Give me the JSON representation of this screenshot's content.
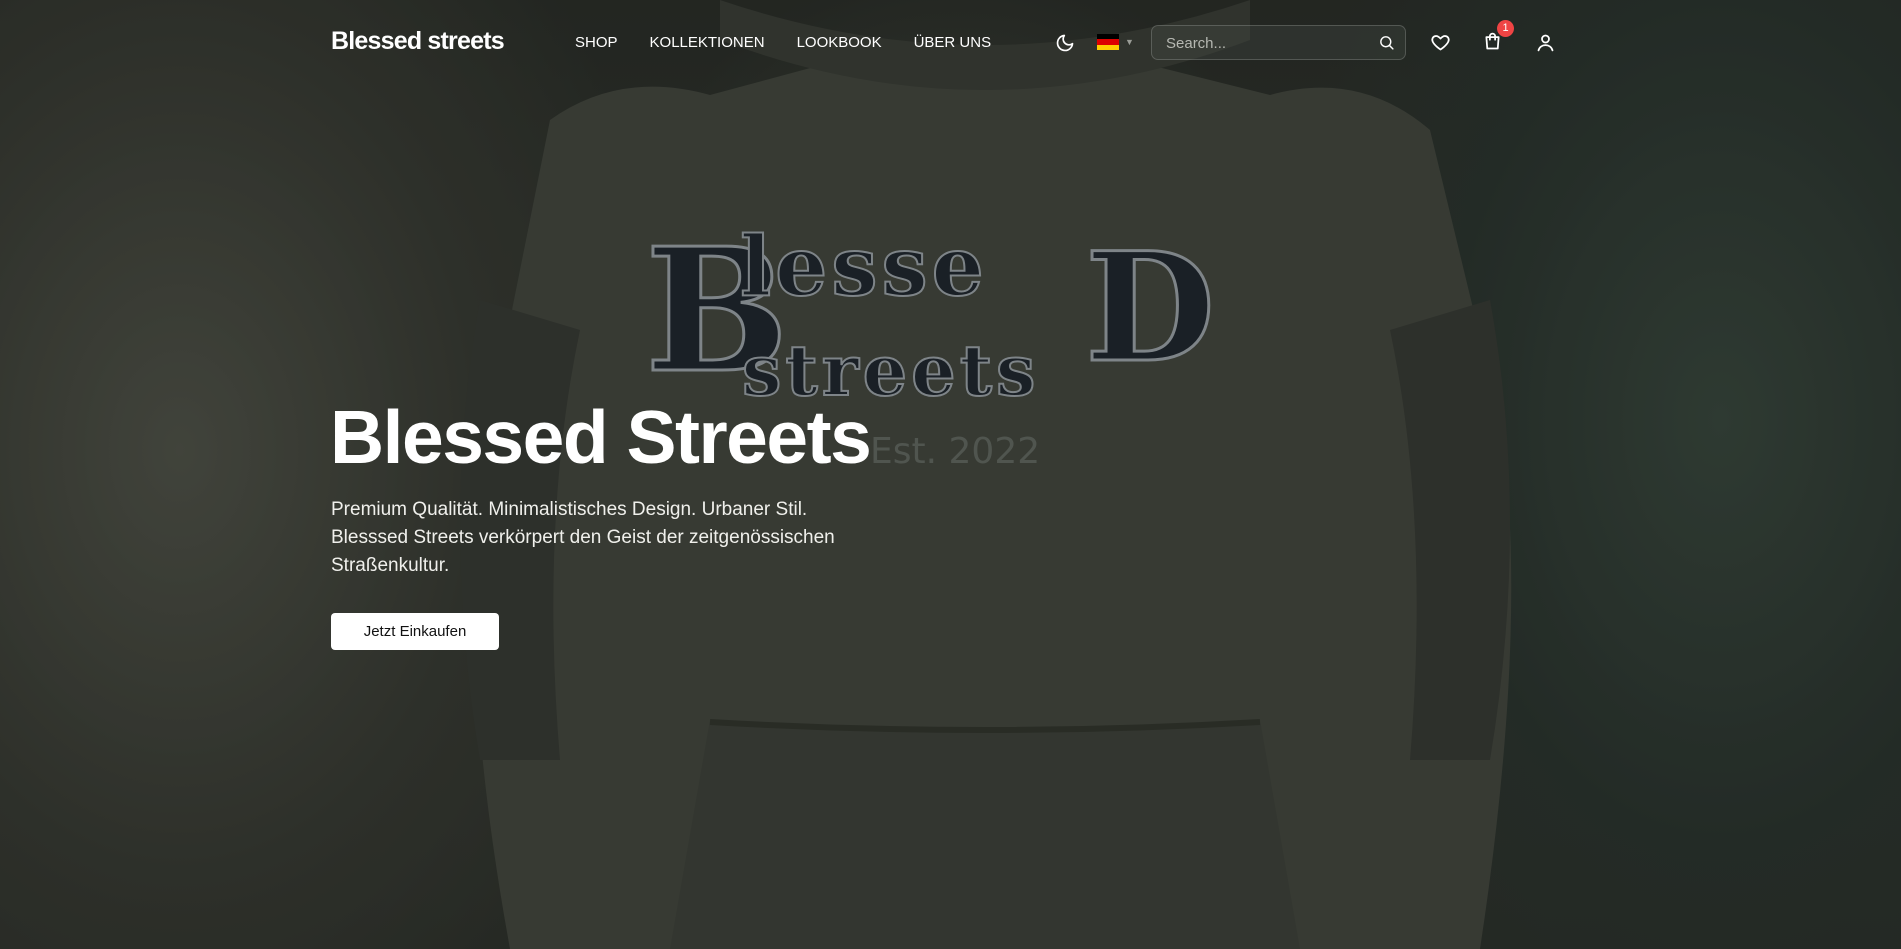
{
  "brand": {
    "logo_text": "Blessed streets"
  },
  "nav": {
    "items": [
      {
        "label": "SHOP"
      },
      {
        "label": "KOLLEKTIONEN"
      },
      {
        "label": "LOOKBOOK"
      },
      {
        "label": "ÜBER UNS"
      }
    ]
  },
  "header": {
    "theme_icon": "moon-icon",
    "language_flag": "flag-de-icon",
    "search": {
      "placeholder": "Search...",
      "value": ""
    },
    "wishlist_icon": "heart-icon",
    "cart_icon": "shopping-bag-icon",
    "cart_count": "1",
    "account_icon": "user-icon"
  },
  "hero": {
    "title": "Blessed Streets",
    "subtitle_lines": [
      "Premium Qualität. Minimalistisches Design. Urbaner Stil.",
      "Blesssed Streets verkörpert den Geist der zeitgenössischen",
      "Straßenkultur."
    ],
    "cta_label": "Jetzt Einkaufen",
    "print_text": "Blessed streets",
    "print_sub": "Est. 2022"
  },
  "colors": {
    "badge": "#ef4444",
    "cta_bg": "#ffffff",
    "flag": [
      "#000000",
      "#dd0000",
      "#ffce00"
    ]
  }
}
